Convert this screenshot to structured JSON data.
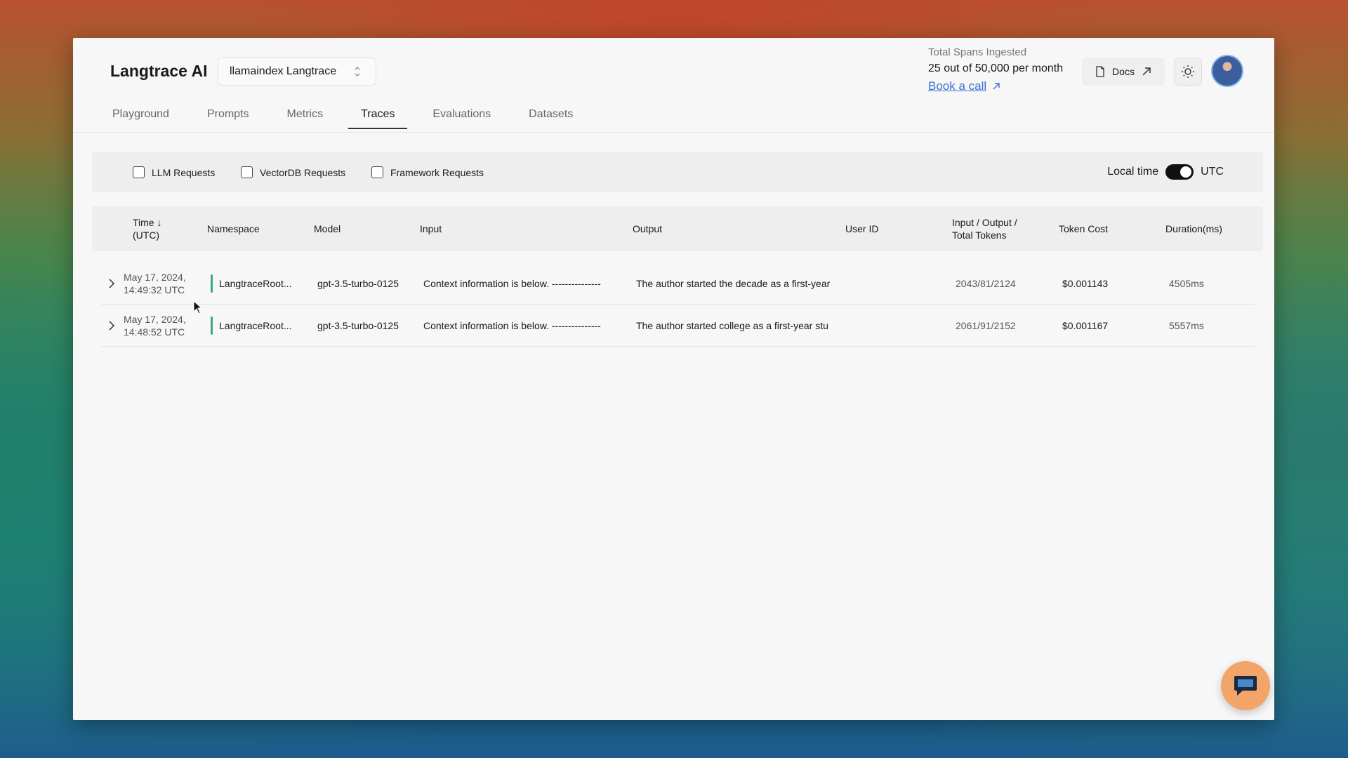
{
  "app": {
    "brand": "Langtrace AI",
    "project": "llamaindex Langtrace"
  },
  "usage": {
    "label": "Total Spans Ingested",
    "value": "25 out of 50,000 per month",
    "book_call": "Book a call"
  },
  "header": {
    "docs_label": "Docs"
  },
  "tabs": [
    {
      "label": "Playground"
    },
    {
      "label": "Prompts"
    },
    {
      "label": "Metrics"
    },
    {
      "label": "Traces",
      "active": true
    },
    {
      "label": "Evaluations"
    },
    {
      "label": "Datasets"
    }
  ],
  "filters": {
    "llm": "LLM Requests",
    "vectordb": "VectorDB Requests",
    "framework": "Framework Requests",
    "local_time": "Local time",
    "utc": "UTC"
  },
  "table": {
    "headers": {
      "time_1": "Time ↓",
      "time_2": "(UTC)",
      "namespace": "Namespace",
      "model": "Model",
      "input": "Input",
      "output": "Output",
      "user_id": "User ID",
      "tokens_1": "Input / Output /",
      "tokens_2": "Total Tokens",
      "cost": "Token Cost",
      "duration": "Duration(ms)"
    },
    "rows": [
      {
        "date": "May 17, 2024,",
        "time": "14:49:32 UTC",
        "namespace": "LangtraceRoot...",
        "model": "gpt-3.5-turbo-0125",
        "input": "Context information is below. ---------------",
        "output": "The author started the decade as a first-year",
        "user_id": "",
        "tokens": "2043/81/2124",
        "cost": "$0.001143",
        "duration": "4505ms"
      },
      {
        "date": "May 17, 2024,",
        "time": "14:48:52 UTC",
        "namespace": "LangtraceRoot...",
        "model": "gpt-3.5-turbo-0125",
        "input": "Context information is below. ---------------",
        "output": "The author started college as a first-year stu",
        "user_id": "",
        "tokens": "2061/91/2152",
        "cost": "$0.001167",
        "duration": "5557ms"
      }
    ]
  },
  "colors": {
    "accent_link": "#3b6fd4",
    "namespace_bar": "#3aaa7a",
    "chat_bubble": "#f3a468"
  }
}
